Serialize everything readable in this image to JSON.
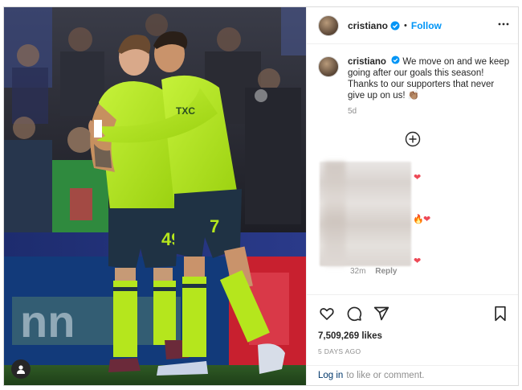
{
  "post": {
    "username": "cristiano",
    "verified": true,
    "dot": "•",
    "follow_label": "Follow",
    "caption_text": "We move on and we keep going after our goals this season! Thanks to our supporters that never give up on us! 👏🏽",
    "caption_age": "5d"
  },
  "comments": {
    "reactions_1": "❤",
    "reactions_2_fire": "🔥",
    "reactions_2_heart": "❤",
    "reactions_3": "❤",
    "last_time": "32m",
    "reply_label": "Reply"
  },
  "actions": {
    "icons": [
      "heart-outline-icon",
      "comment-icon",
      "share-icon",
      "bookmark-icon"
    ],
    "likes": "7,509,269 likes",
    "posted_ago": "5 DAYS AGO"
  },
  "footer": {
    "login_label": "Log in",
    "rest": "to like or comment."
  },
  "colors": {
    "accent": "#0095f6",
    "link": "#00376b",
    "kit_green": "#b5e61d",
    "shorts": "#1f3244",
    "heart": "#ed4956"
  }
}
